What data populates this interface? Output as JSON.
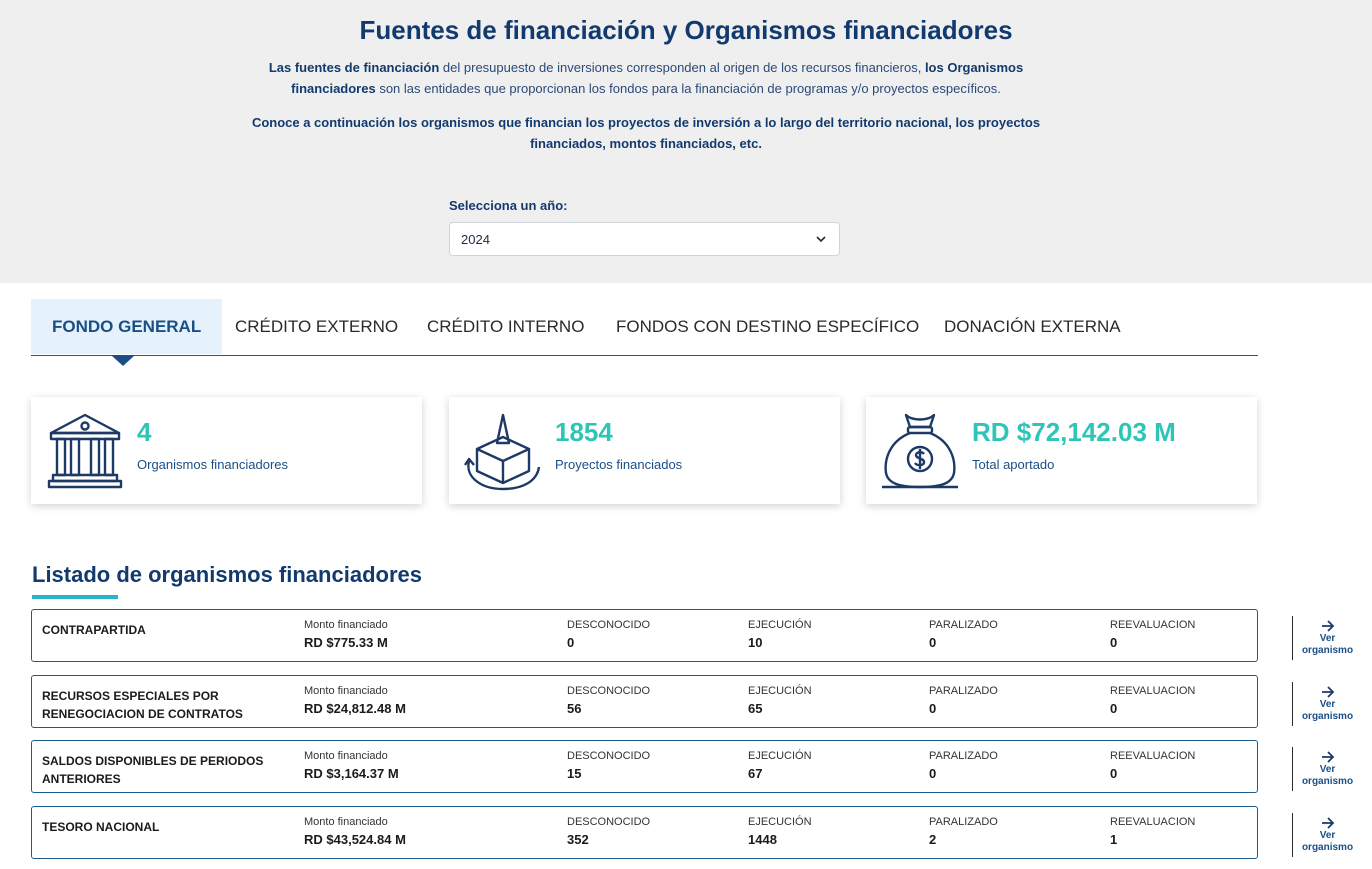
{
  "header": {
    "title": "Fuentes de financiación y Organismos financiadores",
    "desc_b1": "Las fuentes de financiación",
    "desc_t1": " del presupuesto de inversiones corresponden al origen de los recursos financieros, ",
    "desc_b2": "los Organismos financiadores",
    "desc_t2": " son las entidades que proporcionan los fondos para la financiación de programas y/o proyectos específicos.",
    "cta": "Conoce a continuación los organismos que financian los proyectos de inversión a lo largo del territorio nacional, los proyectos financiados, montos financiados, etc."
  },
  "year_select": {
    "label": "Selecciona un año:",
    "value": "2024"
  },
  "tabs": [
    {
      "label": "FONDO GENERAL",
      "active": true
    },
    {
      "label": "CRÉDITO EXTERNO",
      "active": false
    },
    {
      "label": "CRÉDITO INTERNO",
      "active": false
    },
    {
      "label": "FONDOS CON DESTINO ESPECÍFICO",
      "active": false
    },
    {
      "label": "DONACIÓN EXTERNA",
      "active": false
    }
  ],
  "stats": [
    {
      "value": "4",
      "label": "Organismos financiadores",
      "icon": "bank-building-icon"
    },
    {
      "value": "1854",
      "label": "Proyectos financiados",
      "icon": "project-box-icon"
    },
    {
      "value": "RD $72,142.03 M",
      "label": "Total aportado",
      "icon": "money-bag-icon"
    }
  ],
  "list": {
    "title": "Listado de organismos financiadores",
    "columns": {
      "monto": "Monto financiado",
      "desconocido": "DESCONOCIDO",
      "ejecucion": "EJECUCIÓN",
      "paralizado": "PARALIZADO",
      "reevaluacion": "REEVALUACION"
    },
    "action_label_1": "Ver",
    "action_label_2": "organismo",
    "rows": [
      {
        "name": "CONTRAPARTIDA",
        "monto": "RD $775.33 M",
        "desconocido": "0",
        "ejecucion": "10",
        "paralizado": "0",
        "reevaluacion": "0"
      },
      {
        "name": "RECURSOS ESPECIALES POR RENEGOCIACION DE CONTRATOS",
        "monto": "RD $24,812.48 M",
        "desconocido": "56",
        "ejecucion": "65",
        "paralizado": "0",
        "reevaluacion": "0"
      },
      {
        "name": "SALDOS DISPONIBLES DE PERIODOS ANTERIORES",
        "monto": "RD $3,164.37 M",
        "desconocido": "15",
        "ejecucion": "67",
        "paralizado": "0",
        "reevaluacion": "0"
      },
      {
        "name": "TESORO NACIONAL",
        "monto": "RD $43,524.84 M",
        "desconocido": "352",
        "ejecucion": "1448",
        "paralizado": "2",
        "reevaluacion": "1"
      }
    ]
  },
  "colors": {
    "primary": "#123a6e",
    "accent": "#2ec4b6",
    "active_tab_bg": "#e6f2fb",
    "hero_bg": "#efefef"
  }
}
